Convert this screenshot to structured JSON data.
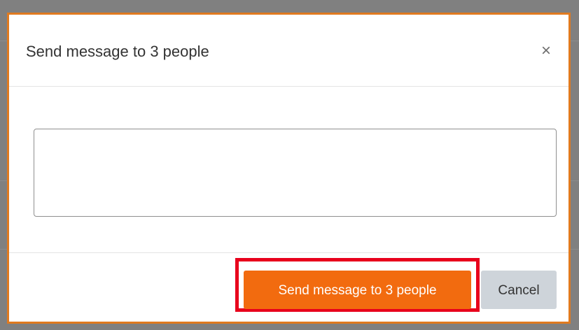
{
  "dialog": {
    "title": "Send message to 3 people",
    "close_icon": "×",
    "message_value": "",
    "message_placeholder": "",
    "send_label": "Send message to 3 people",
    "cancel_label": "Cancel"
  },
  "colors": {
    "dialog_border": "#e07a1f",
    "send_button": "#f26b0f",
    "highlight": "#e8001c",
    "cancel_button": "#ced4da"
  }
}
